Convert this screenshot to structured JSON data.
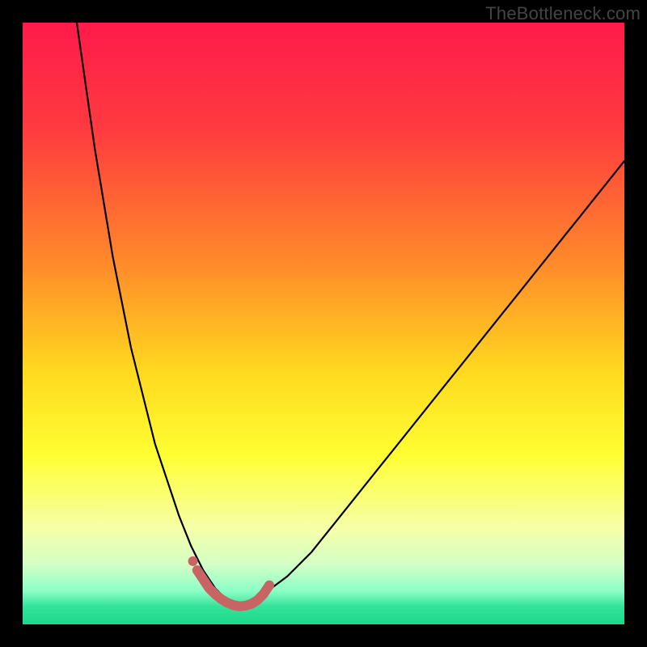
{
  "watermark": "TheBottleneck.com",
  "chart_data": {
    "type": "line",
    "title": "",
    "xlabel": "",
    "ylabel": "",
    "xlim": [
      0,
      100
    ],
    "ylim": [
      0,
      100
    ],
    "gradient_stops": [
      {
        "offset": 0.0,
        "color": "#ff1a4b"
      },
      {
        "offset": 0.18,
        "color": "#ff3b3f"
      },
      {
        "offset": 0.4,
        "color": "#ff8a2a"
      },
      {
        "offset": 0.58,
        "color": "#ffd91f"
      },
      {
        "offset": 0.72,
        "color": "#ffff33"
      },
      {
        "offset": 0.84,
        "color": "#f6ffa8"
      },
      {
        "offset": 0.9,
        "color": "#d4ffc6"
      },
      {
        "offset": 0.945,
        "color": "#8affc6"
      },
      {
        "offset": 0.97,
        "color": "#34e39a"
      },
      {
        "offset": 1.0,
        "color": "#1bd98b"
      }
    ],
    "series": [
      {
        "name": "left-curve",
        "color": "#000000",
        "width": 2.2,
        "x": [
          9,
          10,
          11,
          12,
          13,
          14,
          15,
          16,
          17,
          18,
          19,
          20,
          21,
          22,
          23,
          24,
          25,
          26,
          27,
          28,
          29,
          30,
          31,
          32,
          33
        ],
        "values": [
          100,
          93,
          86,
          79,
          73,
          67,
          61,
          56,
          51,
          46,
          42,
          38,
          34,
          30,
          27,
          24,
          21,
          18,
          15.5,
          13,
          11,
          9,
          7.5,
          6,
          5
        ]
      },
      {
        "name": "right-curve",
        "color": "#000000",
        "width": 2.2,
        "x": [
          40,
          42,
          44,
          46,
          48,
          50,
          52,
          54,
          56,
          58,
          60,
          62,
          64,
          66,
          68,
          70,
          72,
          74,
          76,
          78,
          80,
          82,
          84,
          86,
          88,
          90,
          92,
          94,
          96,
          98,
          100
        ],
        "values": [
          5,
          6.5,
          8,
          10,
          12,
          14.5,
          17,
          19.5,
          22,
          24.5,
          27,
          29.5,
          32,
          34.5,
          37,
          39.5,
          42,
          44.5,
          47,
          49.5,
          52,
          54.5,
          57,
          59.5,
          62,
          64.5,
          67,
          69.5,
          72,
          74.5,
          77
        ]
      },
      {
        "name": "highlight-band",
        "color": "#c86464",
        "width": 12,
        "x": [
          29,
          30,
          31,
          32,
          33,
          34,
          35,
          36,
          37,
          38,
          39,
          40,
          41
        ],
        "values": [
          9,
          7.5,
          6,
          5,
          4.2,
          3.6,
          3.2,
          3,
          3.1,
          3.4,
          4,
          5,
          6.5
        ]
      },
      {
        "name": "highlight-dot",
        "color": "#c86464",
        "type_hint": "scatter",
        "x": [
          28.3
        ],
        "values": [
          10.5
        ],
        "radius": 6
      }
    ]
  }
}
